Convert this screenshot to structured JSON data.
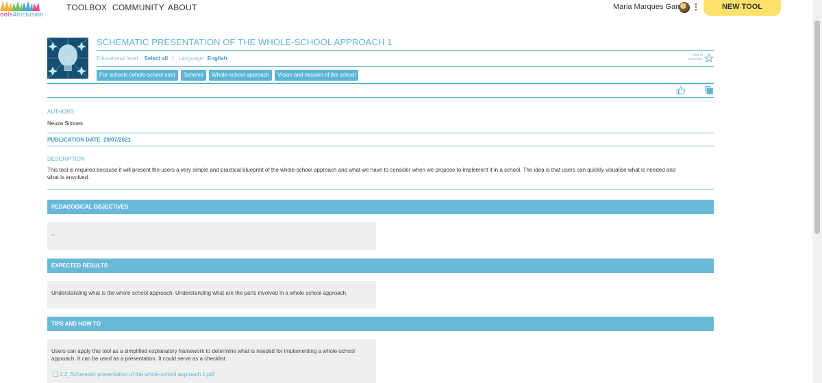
{
  "header": {
    "logo_text": "ools",
    "logo_text_accent": "4Inclusion",
    "nav": [
      "TOOLBOX",
      "COMMUNITY",
      "ABOUT"
    ],
    "user_name": "Maria Marques Gama",
    "new_tool": "NEW TOOL"
  },
  "tool": {
    "title": "SCHEMATIC PRESENTATION OF THE WHOLE-SCHOOL APPROACH 1",
    "edu_level_label": "Educational level :",
    "edu_level_value": "Select all",
    "sep": "|",
    "language_label": "Language:",
    "language_value": "English",
    "favourites_label_1": "Add to",
    "favourites_label_2": "favourites",
    "tags": [
      "For schools (whole-school use)",
      "Scheme",
      "Whole-school approach",
      "Vision and mission of the school"
    ]
  },
  "authors": {
    "label": "AUTHORS",
    "value": "Neuza Simoes"
  },
  "publication": {
    "label": "PUBLICATION DATE",
    "value": "29/07/2021"
  },
  "description": {
    "label": "DESCRIPTION",
    "line1": "This tool is required because it will present the users a very simple and practical blueprint of the whole-school approach and what we have to consider when we propose to implement it in a school. The idea is that users can quickly visualise what is needed and",
    "line2": "what is envolved."
  },
  "sections": {
    "objectives": {
      "title": "PEDAGOGICAL OBJECTIVES",
      "content": "--"
    },
    "results": {
      "title": "EXPECTED RESULTS",
      "content": "Understanding what is the whole school approach. Understanding what are the parts involved in a whole school approach."
    },
    "tips": {
      "title": "TIPS AND HOW TO",
      "line1": "Users can apply this tool as a simplified explanatory framework to determine what is needed for implementing a whole-school",
      "line2": "approach. It can be used as a presentation. It could serve as a checklist.",
      "file": "2.2_Schematic presentation of the whole-school approach 1.pdf"
    }
  },
  "colors": {
    "accent": "#5eb4d4",
    "section_bg": "#68b8d8",
    "new_tool_bg": "#fde16b"
  }
}
